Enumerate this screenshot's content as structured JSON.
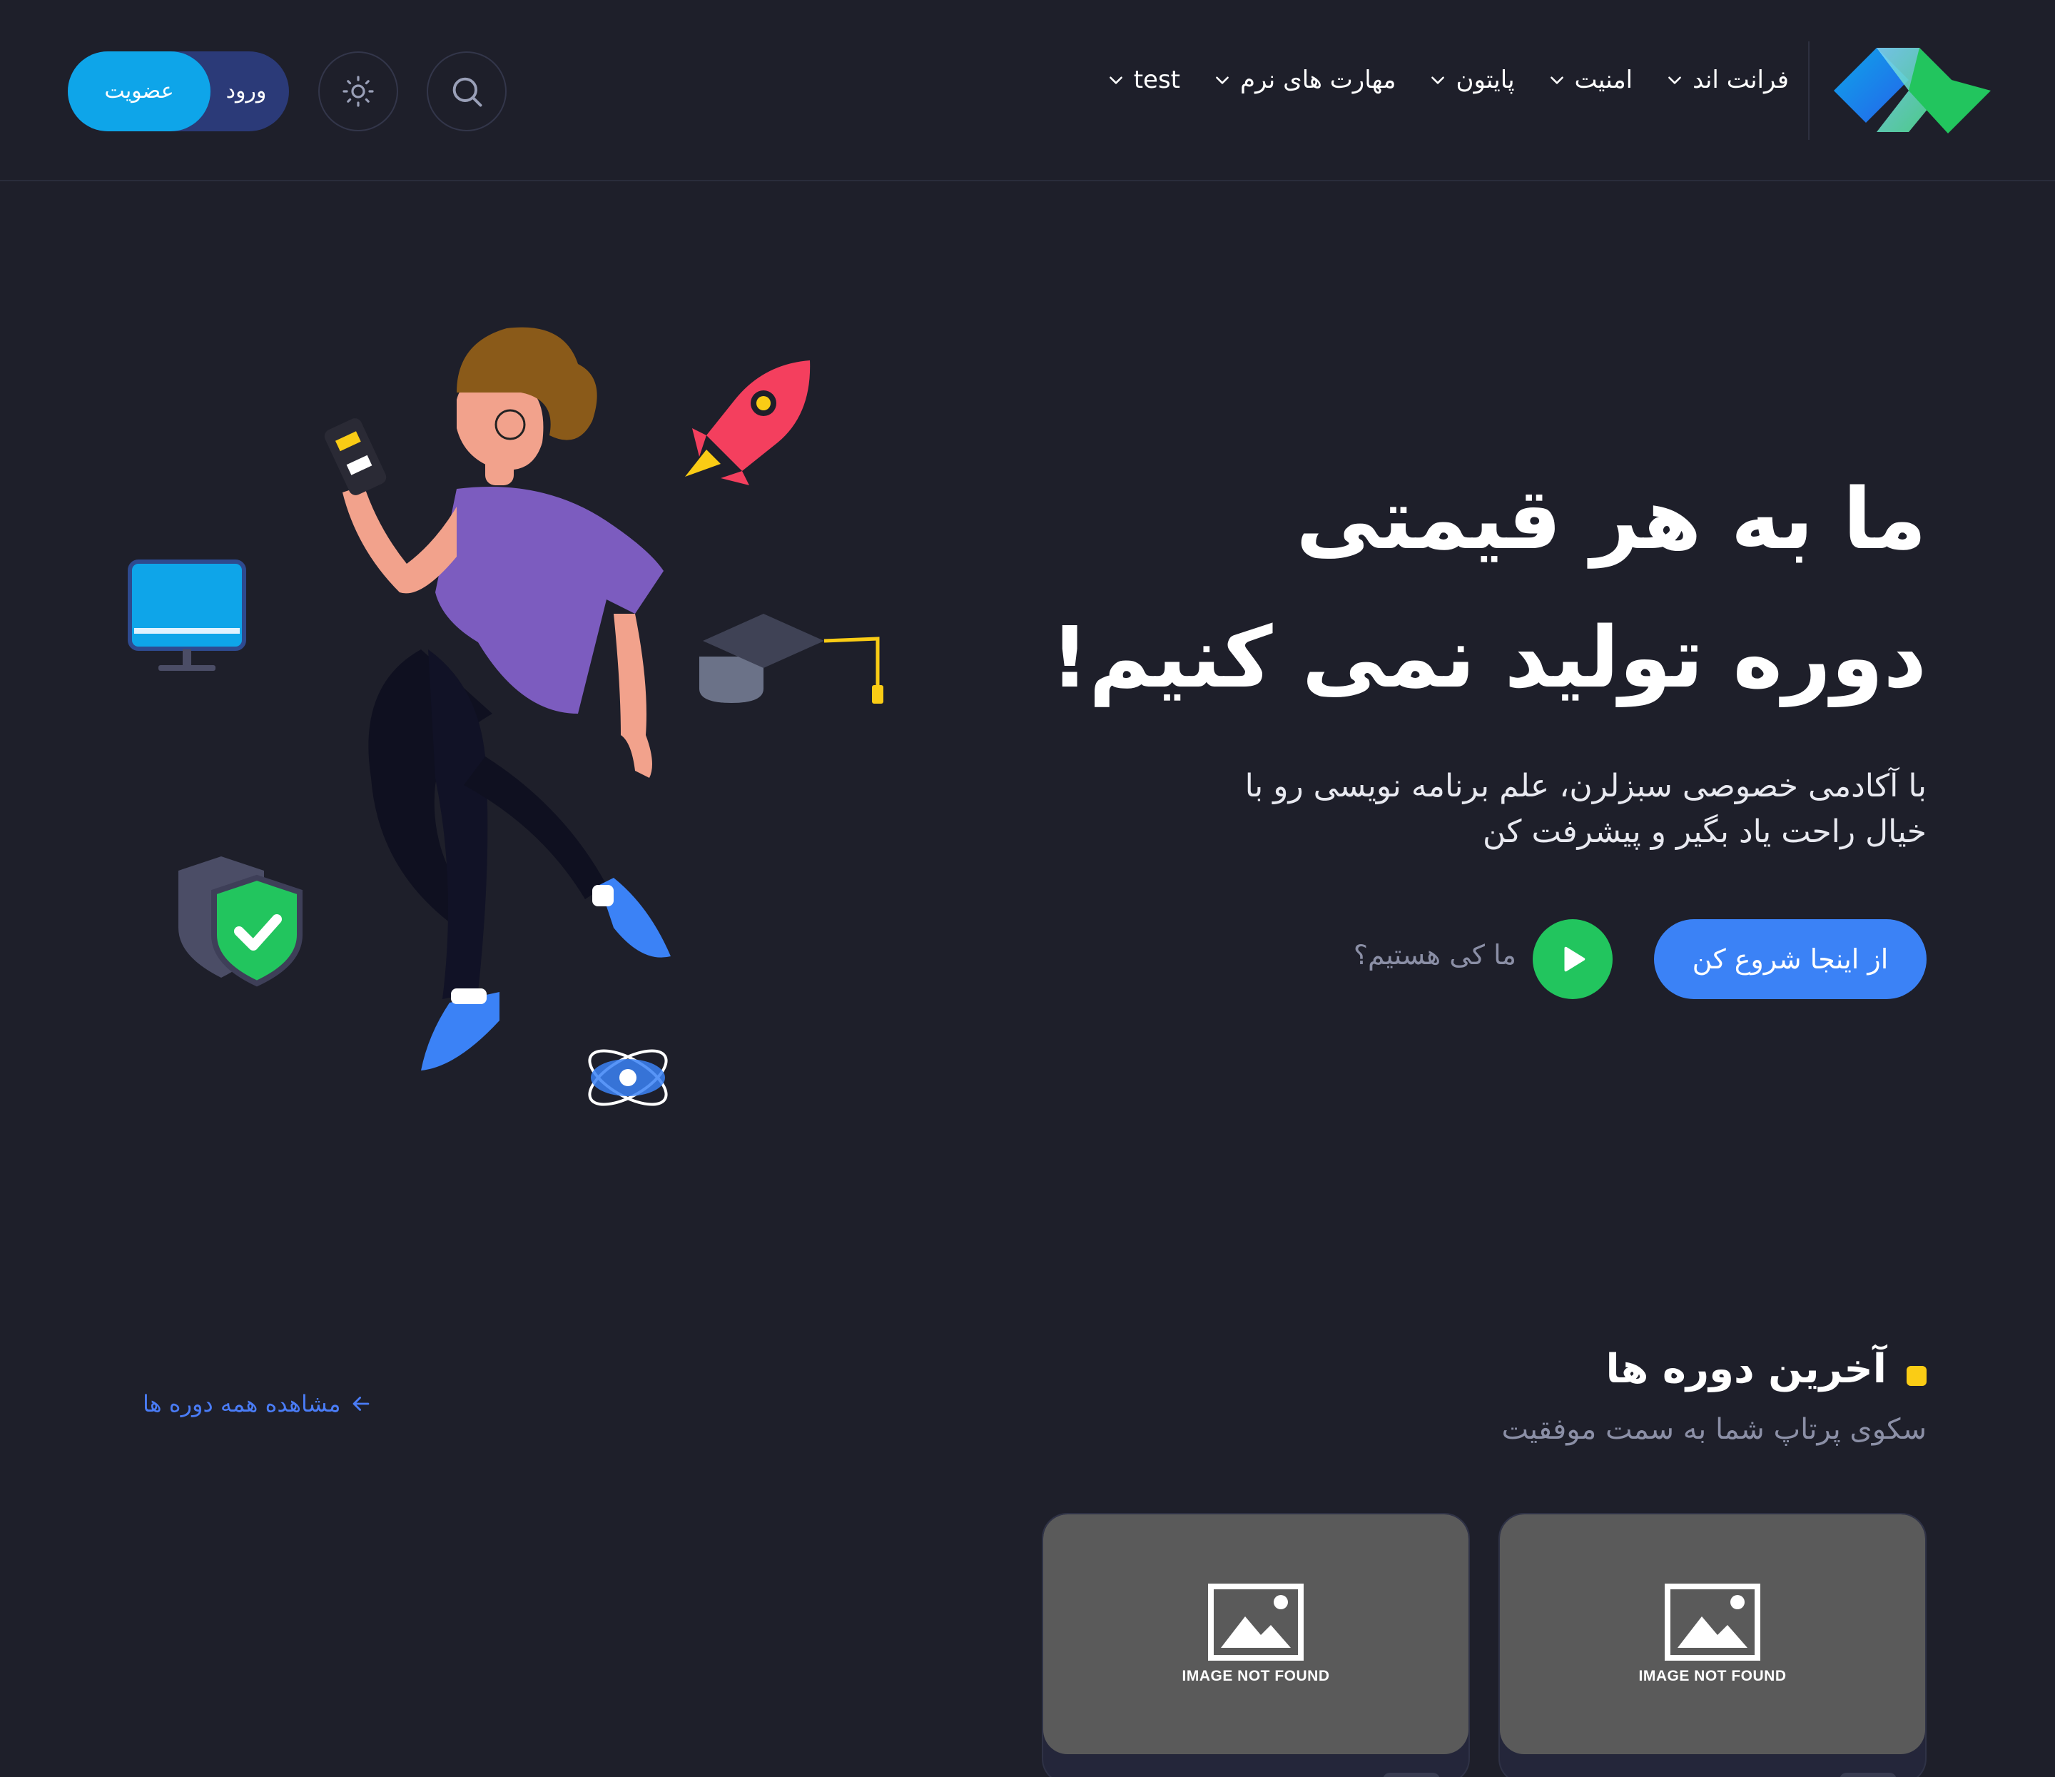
{
  "header": {
    "nav": [
      {
        "label": "فرانت اند"
      },
      {
        "label": "امنیت"
      },
      {
        "label": "پایتون"
      },
      {
        "label": "مهارت های نرم"
      },
      {
        "label": "test"
      }
    ],
    "login_label": "ورود",
    "signup_label": "عضویت"
  },
  "hero": {
    "title_line1": "ما به هر قیمتی",
    "title_line2": "دوره تولید نمی کنیم!",
    "description": "با آکادمی خصوصی سبزلرن، علم برنامه نویسی رو با خیال راحت یاد بگیر و پیشرفت کن",
    "start_button": "از اینجا شروع کن",
    "about_link": "ما کی هستیم؟"
  },
  "latest_courses": {
    "title": "آخرین دوره ها",
    "subtitle": "سکوی پرتاپ شما به سمت موفقیت",
    "view_all": "مشاهده همه دوره ها",
    "cards": [
      {
        "image_label": "IMAGE NOT FOUND"
      },
      {
        "image_label": "IMAGE NOT FOUND"
      }
    ]
  },
  "colors": {
    "background": "#1e1f2a",
    "primary": "#3b82f6",
    "signup": "#0ea5e9",
    "success": "#22c55e",
    "accent": "#facc15"
  },
  "icons": [
    "logo",
    "chevron-down-icon",
    "search-icon",
    "sun-icon",
    "play-icon",
    "arrow-left-icon",
    "image-placeholder-icon"
  ]
}
